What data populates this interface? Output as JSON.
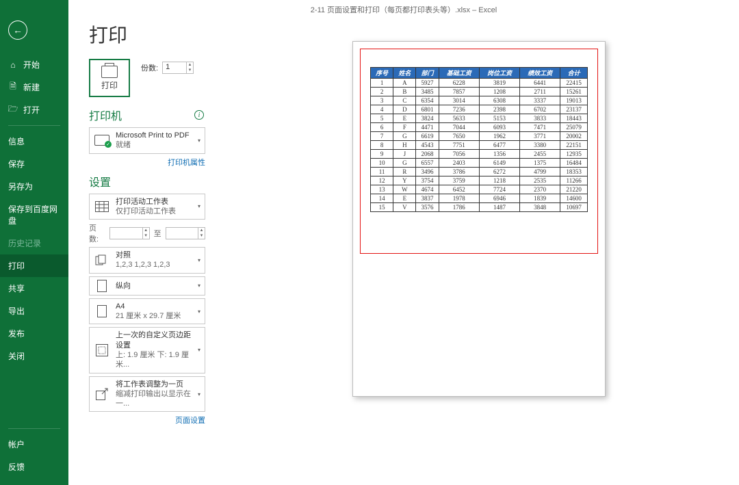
{
  "title_bar": "2-11 页面设置和打印（每页都打印表头等）.xlsx – Excel",
  "page_heading": "打印",
  "sidebar": {
    "items": [
      {
        "label": "开始",
        "icon": "home"
      },
      {
        "label": "新建",
        "icon": "new"
      },
      {
        "label": "打开",
        "icon": "open"
      },
      {
        "label": "信息",
        "icon": ""
      },
      {
        "label": "保存",
        "icon": ""
      },
      {
        "label": "另存为",
        "icon": ""
      },
      {
        "label": "保存到百度网盘",
        "icon": ""
      },
      {
        "label": "历史记录",
        "icon": ""
      },
      {
        "label": "打印",
        "icon": ""
      },
      {
        "label": "共享",
        "icon": ""
      },
      {
        "label": "导出",
        "icon": ""
      },
      {
        "label": "发布",
        "icon": ""
      },
      {
        "label": "关闭",
        "icon": ""
      }
    ],
    "bottom": [
      {
        "label": "帐户"
      },
      {
        "label": "反馈"
      }
    ]
  },
  "print_button_label": "打印",
  "copies": {
    "label": "份数:",
    "value": "1"
  },
  "printer_section": {
    "heading": "打印机",
    "name": "Microsoft Print to PDF",
    "status": "就绪",
    "props_link": "打印机属性"
  },
  "settings_section": {
    "heading": "设置",
    "items": [
      {
        "t1": "打印活动工作表",
        "t2": "仅打印活动工作表",
        "icon": "sheet"
      },
      {
        "t1": "对照",
        "t2": "1,2,3    1,2,3    1,2,3",
        "icon": "collate"
      },
      {
        "t1": "纵向",
        "t2": "",
        "icon": "orient"
      },
      {
        "t1": "A4",
        "t2": "21 厘米 x 29.7 厘米",
        "icon": "paper"
      },
      {
        "t1": "上一次的自定义页边距设置",
        "t2": "上: 1.9 厘米 下: 1.9 厘米...",
        "icon": "margin"
      },
      {
        "t1": "将工作表调整为一页",
        "t2": "缩减打印输出以显示在一...",
        "icon": "fit"
      }
    ],
    "pages": {
      "label": "页数:",
      "to": "至"
    },
    "page_setup_link": "页面设置"
  },
  "preview": {
    "headers": [
      "序号",
      "姓名",
      "部门",
      "基础工资",
      "岗位工资",
      "绩效工资",
      "合计"
    ],
    "rows": [
      [
        "1",
        "A",
        "5927",
        "6228",
        "3819",
        "6441",
        "22415"
      ],
      [
        "2",
        "B",
        "3485",
        "7857",
        "1208",
        "2711",
        "15261"
      ],
      [
        "3",
        "C",
        "6354",
        "3014",
        "6308",
        "3337",
        "19013"
      ],
      [
        "4",
        "D",
        "6801",
        "7236",
        "2398",
        "6702",
        "23137"
      ],
      [
        "5",
        "E",
        "3824",
        "5633",
        "5153",
        "3833",
        "18443"
      ],
      [
        "6",
        "F",
        "4471",
        "7044",
        "6093",
        "7471",
        "25079"
      ],
      [
        "7",
        "G",
        "6619",
        "7650",
        "1962",
        "3771",
        "20002"
      ],
      [
        "8",
        "H",
        "4543",
        "7751",
        "6477",
        "3380",
        "22151"
      ],
      [
        "9",
        "J",
        "2068",
        "7056",
        "1356",
        "2455",
        "12935"
      ],
      [
        "10",
        "G",
        "6557",
        "2403",
        "6149",
        "1375",
        "16484"
      ],
      [
        "11",
        "R",
        "3496",
        "3786",
        "6272",
        "4799",
        "18353"
      ],
      [
        "12",
        "Y",
        "3754",
        "3759",
        "1218",
        "2535",
        "11266"
      ],
      [
        "13",
        "W",
        "4674",
        "6452",
        "7724",
        "2370",
        "21220"
      ],
      [
        "14",
        "E",
        "3837",
        "1978",
        "6946",
        "1839",
        "14600"
      ],
      [
        "15",
        "V",
        "3576",
        "1786",
        "1487",
        "3848",
        "10697"
      ]
    ]
  }
}
